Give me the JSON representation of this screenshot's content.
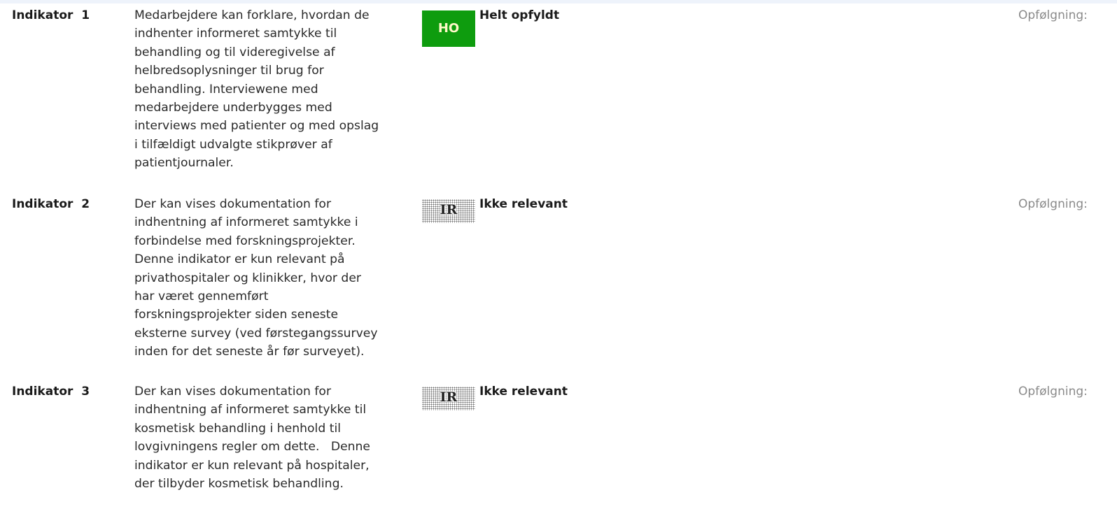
{
  "indicators": [
    {
      "label": "Indikator  1",
      "text_lines": [
        "Medarbejdere kan forklare, hvordan de",
        "indhenter informeret samtykke til",
        "behandling og til videregivelse af",
        "helbredsoplysninger til brug for",
        "behandling. Interviewene med",
        "medarbejdere underbygges med",
        "interviews med patienter og med opslag",
        "i tilfældigt udvalgte stikprøver af",
        "patientjournaler."
      ],
      "badge": "HO",
      "badge_color": "#0e9c0e",
      "status": "Helt opfyldt",
      "followup": "Opfølgning:"
    },
    {
      "label": "Indikator  2",
      "text_lines": [
        "Der kan vises dokumentation for",
        "indhentning af informeret samtykke i",
        "forbindelse med forskningsprojekter.",
        "Denne indikator er kun relevant på",
        "privathospitaler og klinikker, hvor der",
        "har været gennemført",
        "forskningsprojekter siden seneste",
        "eksterne survey (ved førstegangssurvey",
        "inden for det seneste år før surveyet)."
      ],
      "badge": "IR",
      "badge_color": "#6a6a6a",
      "status": "Ikke relevant",
      "followup": "Opfølgning:"
    },
    {
      "label": "Indikator  3",
      "text_lines": [
        "Der kan vises dokumentation for",
        "indhentning af informeret samtykke til",
        "kosmetisk behandling i henhold til",
        "lovgivningens regler om dette.   Denne",
        "indikator er kun relevant på hospitaler,",
        "der tilbyder kosmetisk behandling."
      ],
      "badge": "IR",
      "badge_color": "#6a6a6a",
      "status": "Ikke relevant",
      "followup": "Opfølgning:"
    }
  ]
}
